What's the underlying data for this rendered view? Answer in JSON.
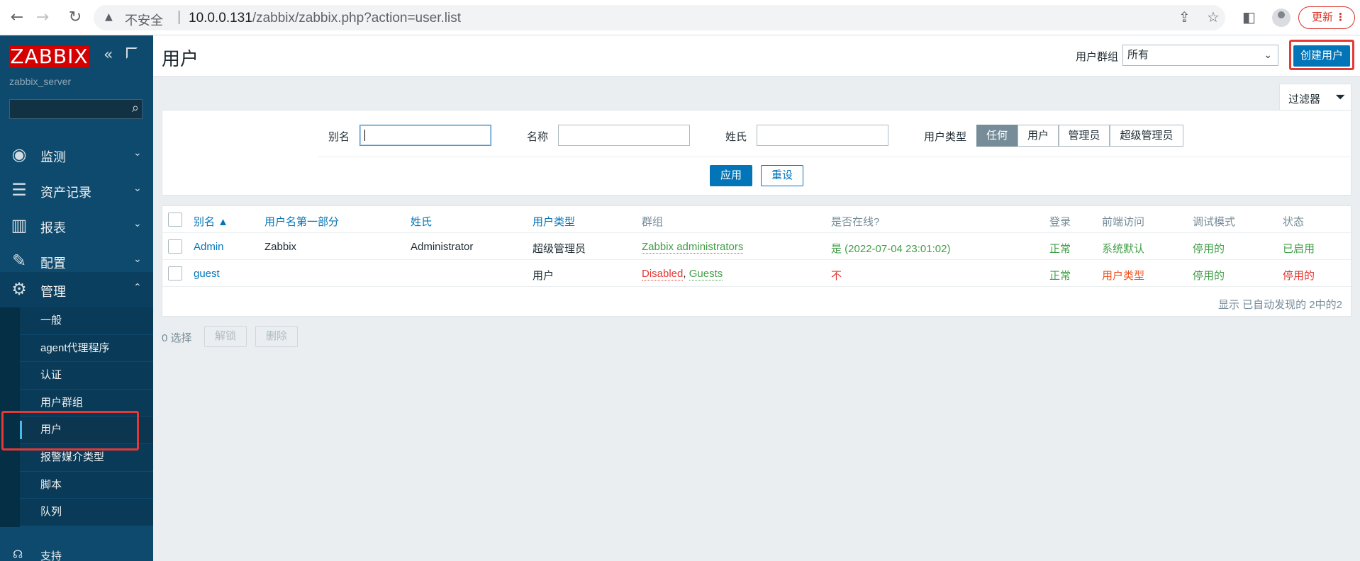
{
  "browser": {
    "insecure_label": "不安全",
    "separator": "|",
    "url_host": "10.0.0.131",
    "url_path": "/zabbix/zabbix.php?action=user.list",
    "update_label": "更新",
    "more_label": "⋮"
  },
  "sidebar": {
    "logo": "ZABBIX",
    "server_name": "zabbix_server",
    "search_placeholder": "",
    "menu": [
      {
        "label": "监测",
        "icon": "eye-icon"
      },
      {
        "label": "资产记录",
        "icon": "list-icon"
      },
      {
        "label": "报表",
        "icon": "bar-chart-icon"
      },
      {
        "label": "配置",
        "icon": "wrench-icon"
      },
      {
        "label": "管理",
        "icon": "gear-icon"
      }
    ],
    "submenu": [
      "一般",
      "agent代理程序",
      "认证",
      "用户群组",
      "用户",
      "报警媒介类型",
      "脚本",
      "队列"
    ],
    "selected_submenu": "用户",
    "support_label": "支持"
  },
  "header": {
    "title": "用户",
    "group_label": "用户群组",
    "group_value": "所有",
    "create_button": "创建用户"
  },
  "filter": {
    "tab_label": "过滤器",
    "alias_label": "别名",
    "alias_value": "",
    "name_label": "名称",
    "name_value": "",
    "surname_label": "姓氏",
    "surname_value": "",
    "type_label": "用户类型",
    "type_options": [
      "任何",
      "用户",
      "管理员",
      "超级管理员"
    ],
    "type_selected": "任何",
    "apply_label": "应用",
    "reset_label": "重设"
  },
  "table": {
    "columns": [
      "别名 ▲",
      "用户名第一部分",
      "姓氏",
      "用户类型",
      "群组",
      "是否在线?",
      "登录",
      "前端访问",
      "调试模式",
      "状态"
    ],
    "rows": [
      {
        "alias": "Admin",
        "name": "Zabbix",
        "surname": "Administrator",
        "type": "超级管理员",
        "groups": [
          "Zabbix administrators"
        ],
        "online": "是 (2022-07-04 23:01:02)",
        "login": "正常",
        "frontend": "系统默认",
        "debug": "停用的",
        "status": "已启用"
      },
      {
        "alias": "guest",
        "name": "",
        "surname": "",
        "type": "用户",
        "groups": [
          "Disabled",
          "Guests"
        ],
        "group_sep": ",",
        "online": "不",
        "login": "正常",
        "frontend": "用户类型",
        "debug": "停用的",
        "status": "停用的"
      }
    ],
    "footer": "显示 已自动发现的 2中的2"
  },
  "actions": {
    "selected_count": "0 选择",
    "unlock_label": "解锁",
    "delete_label": "删除"
  },
  "colors": {
    "sidebar_bg": "#0d4a6e",
    "primary": "#0275b8",
    "highlight_box": "#e53935",
    "ok_green": "#429e47",
    "error_red": "#e33734"
  }
}
